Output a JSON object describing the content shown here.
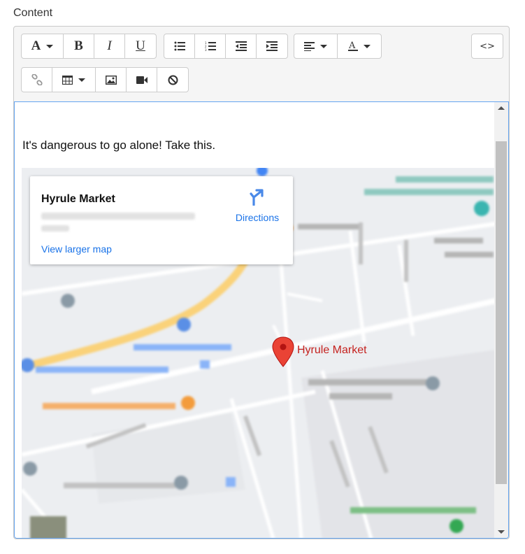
{
  "field": {
    "label": "Content"
  },
  "toolbar": {
    "font_style": "A",
    "bold": "B",
    "italic": "I",
    "underline": "U",
    "code_view": "<>"
  },
  "content": {
    "text": "It's dangerous to go alone! Take this."
  },
  "map": {
    "place_name": "Hyrule Market",
    "directions_label": "Directions",
    "view_larger_label": "View larger map",
    "marker_label": "Hyrule Market"
  },
  "colors": {
    "link_blue": "#1a73e8",
    "marker_red": "#ea4335",
    "editor_focus_border": "#66a6f0"
  }
}
